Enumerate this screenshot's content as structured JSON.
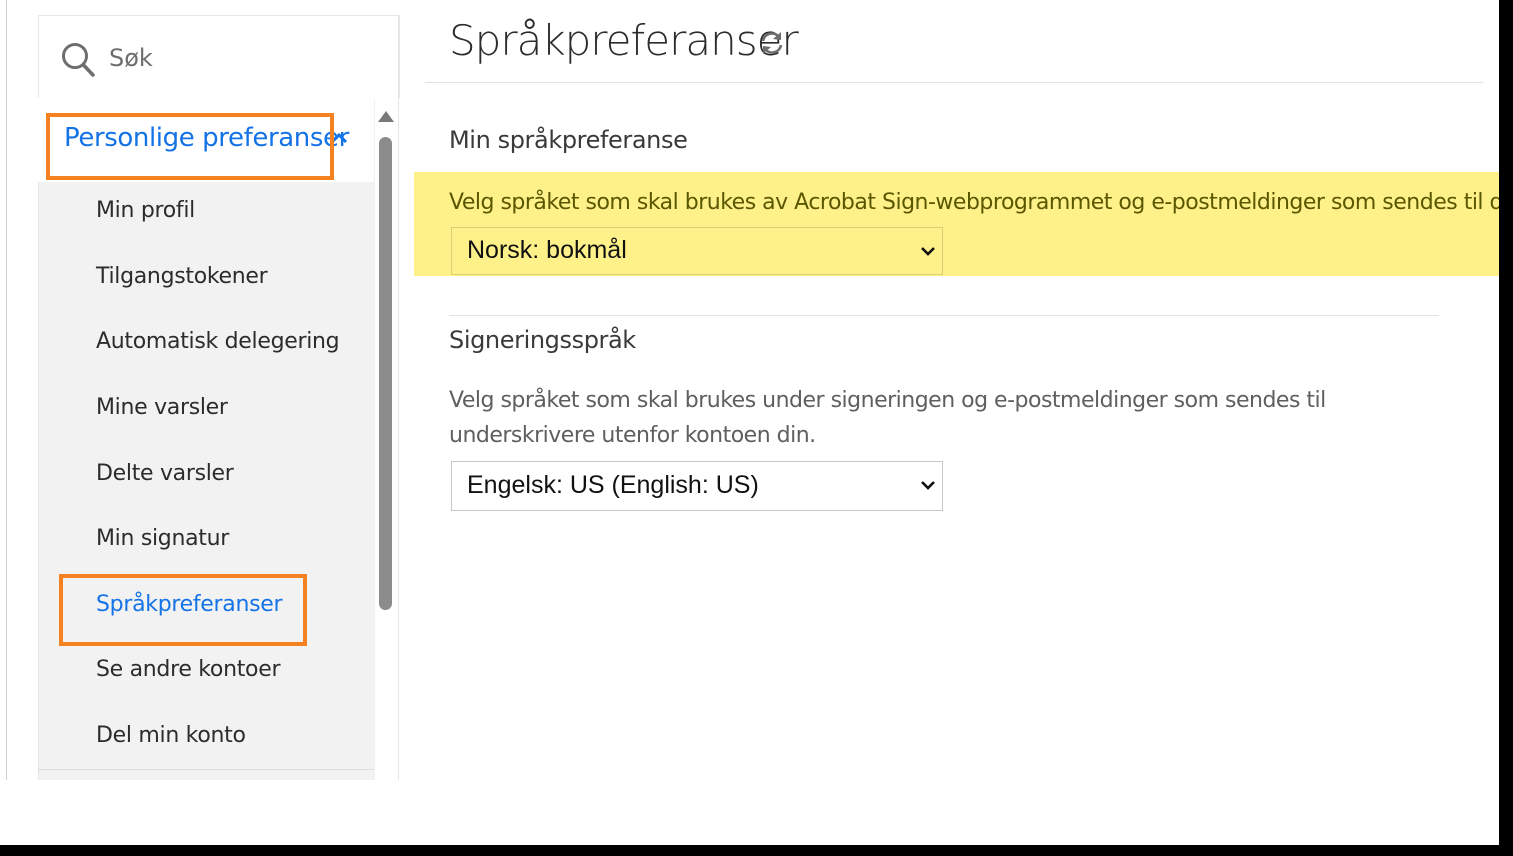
{
  "sidebar": {
    "search": {
      "placeholder": "Søk",
      "icon": "search-icon"
    },
    "group": {
      "label": "Personlige preferanser",
      "icon": "chevron-up-icon",
      "expanded": true
    },
    "items": [
      {
        "label": "Min profil",
        "active": false
      },
      {
        "label": "Tilgangstokener",
        "active": false
      },
      {
        "label": "Automatisk delegering",
        "active": false
      },
      {
        "label": "Mine varsler",
        "active": false
      },
      {
        "label": "Delte varsler",
        "active": false
      },
      {
        "label": "Min signatur",
        "active": false
      },
      {
        "label": "Språkpreferanser",
        "active": true
      },
      {
        "label": "Se andre kontoer",
        "active": false
      },
      {
        "label": "Del min konto",
        "active": false
      }
    ]
  },
  "page": {
    "title": "Språkpreferanser",
    "refresh_icon": "refresh-icon"
  },
  "my_language": {
    "heading": "Min språkpreferanse",
    "description": "Velg språket som skal brukes av Acrobat Sign-webprogrammet og e-postmeldinger som sendes til deg.",
    "selected": "Norsk: bokmål"
  },
  "signing_language": {
    "heading": "Signeringsspråk",
    "description": "Velg språket som skal brukes under signeringen og e-postmeldinger som sendes til underskrivere utenfor kontoen din.",
    "selected": "Engelsk: US (English: US)"
  },
  "colors": {
    "accent": "#1473e6",
    "callout": "#f58220",
    "highlight": "#fff18a"
  }
}
